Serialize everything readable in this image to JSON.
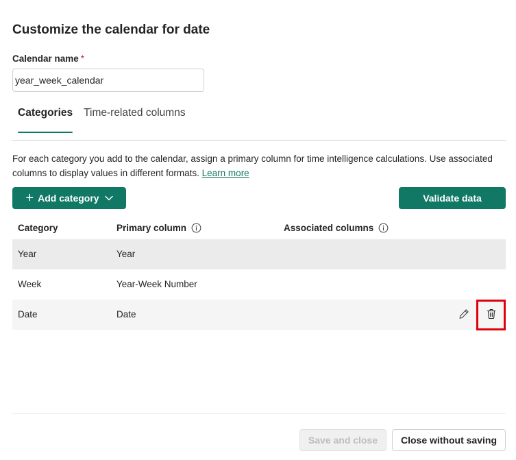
{
  "dialog": {
    "title": "Customize the calendar for date",
    "name_label": "Calendar name",
    "required_marker": "*",
    "name_value": "year_week_calendar"
  },
  "tabs": [
    {
      "label": "Categories",
      "active": true
    },
    {
      "label": "Time-related columns",
      "active": false
    }
  ],
  "description": {
    "text": "For each category you add to the calendar, assign a primary column for time intelligence calculations. Use associated columns to display values in different formats.",
    "link": "Learn more"
  },
  "toolbar": {
    "add_label": "Add category",
    "validate_label": "Validate data"
  },
  "table": {
    "headers": [
      "Category",
      "Primary column",
      "Associated columns"
    ],
    "rows": [
      {
        "category": "Year",
        "primary": "Year",
        "associated": ""
      },
      {
        "category": "Week",
        "primary": "Year-Week Number",
        "associated": ""
      },
      {
        "category": "Date",
        "primary": "Date",
        "associated": ""
      }
    ]
  },
  "footer": {
    "save_label": "Save and close",
    "close_label": "Close without saving"
  },
  "icons": {
    "add": "plus-icon",
    "dropdown": "chevron-down-icon",
    "info": "info-icon",
    "edit": "pencil-icon",
    "delete": "trash-icon"
  },
  "colors": {
    "accent": "#117865",
    "highlight": "#e0000a"
  }
}
